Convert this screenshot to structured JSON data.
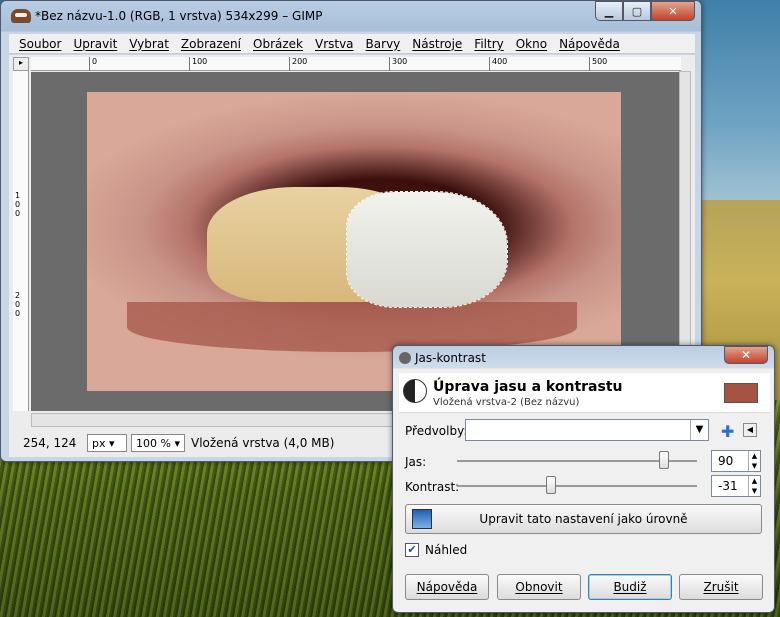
{
  "main_window": {
    "title": "*Bez názvu-1.0 (RGB, 1 vrstva) 534x299 – GIMP",
    "menu": [
      "Soubor",
      "Upravit",
      "Vybrat",
      "Zobrazení",
      "Obrázek",
      "Vrstva",
      "Barvy",
      "Nástroje",
      "Filtry",
      "Okno",
      "Nápověda"
    ],
    "ruler_ticks": [
      "0",
      "100",
      "200",
      "300",
      "400",
      "500"
    ],
    "ruler_v_ticks": [
      "1\n0\n0",
      "2\n0\n0"
    ],
    "status": {
      "coords": "254, 124",
      "unit": "px",
      "zoom": "100 %",
      "layer_info": "Vložená vrstva (4,0 MB)"
    }
  },
  "dialog": {
    "title": "Jas-kontrast",
    "heading": "Úprava jasu a kontrastu",
    "subheading": "Vložená vrstva-2 (Bez názvu)",
    "presets_label": "Předvolby:",
    "presets_value": "",
    "brightness_label": "Jas:",
    "brightness_value": "90",
    "contrast_label": "Kontrast:",
    "contrast_value": "-31",
    "levels_button": "Upravit tato nastavení jako úrovně",
    "preview_label": "Náhled",
    "preview_checked": true,
    "buttons": {
      "help": "Nápověda",
      "reset": "Obnovit",
      "ok": "Budiž",
      "cancel": "Zrušit"
    }
  },
  "icons": [
    "gimp-icon",
    "close-icon",
    "maximize-icon",
    "minimize-icon",
    "brightness-contrast-icon",
    "levels-icon",
    "add-preset-icon",
    "preset-menu-icon",
    "navigate-icon"
  ]
}
